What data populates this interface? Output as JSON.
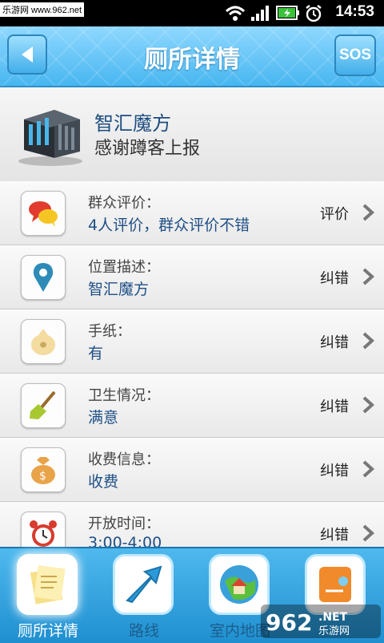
{
  "status_bar": {
    "watermark": "乐游网 www.962.net",
    "time": "14:53"
  },
  "header": {
    "title": "厕所详情",
    "sos_label": "SOS"
  },
  "place": {
    "name": "智汇魔方",
    "note": "感谢蹲客上报"
  },
  "rows": [
    {
      "icon": "speech-bubbles-icon",
      "label": "群众评价：",
      "value": "4人评价，群众评价不错",
      "action": "评价"
    },
    {
      "icon": "map-pin-icon",
      "label": "位置描述：",
      "value": "智汇魔方",
      "action": "纠错"
    },
    {
      "icon": "tissue-roll-icon",
      "label": "手纸：",
      "value": "有",
      "action": "纠错"
    },
    {
      "icon": "broom-icon",
      "label": "卫生情况：",
      "value": "满意",
      "action": "纠错"
    },
    {
      "icon": "money-bag-icon",
      "label": "收费信息：",
      "value": "收费",
      "action": "纠错"
    },
    {
      "icon": "alarm-clock-icon",
      "label": "开放时间：",
      "value": "3:00-4:00",
      "action": "纠错"
    }
  ],
  "tabs": [
    {
      "label": "厕所详情",
      "icon": "notes-icon",
      "active": true
    },
    {
      "label": "路线",
      "icon": "arrow-icon",
      "active": false
    },
    {
      "label": "室内地图",
      "icon": "globe-house-icon",
      "active": false
    },
    {
      "label": "",
      "icon": "orange-card-icon",
      "active": false
    }
  ],
  "brand_overlay": {
    "text_big": "962",
    "text_small": ".NET",
    "text_cn": "乐游网"
  },
  "colors": {
    "accent": "#47b6f0",
    "value_text": "#1f4f86"
  }
}
